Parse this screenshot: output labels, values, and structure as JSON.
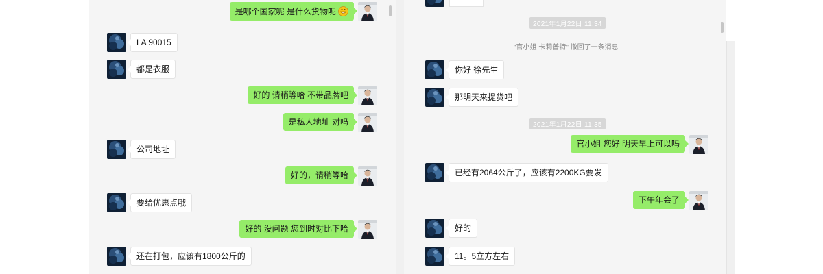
{
  "left_chat": {
    "messages": [
      {
        "dir": "out",
        "text": "是哪个国家呢 是什么货物呢",
        "emoji": "grin-emoji"
      },
      {
        "dir": "in",
        "text": "LA 90015"
      },
      {
        "dir": "in",
        "text": "都是衣服"
      },
      {
        "dir": "out",
        "text": "好的 请稍等哈 不带品牌吧"
      },
      {
        "dir": "out",
        "text": "是私人地址 对吗"
      },
      {
        "dir": "in",
        "text": "公司地址"
      },
      {
        "dir": "out",
        "text": "好的，请稍等哈"
      },
      {
        "dir": "in",
        "text": "要给优惠点哦"
      },
      {
        "dir": "out",
        "text": "好的 没问题 您到时对比下哈"
      },
      {
        "dir": "in",
        "text": "还在打包，应该有1800公斤的"
      }
    ]
  },
  "right_chat": {
    "timestamp_1": "2021年1月22日 11:34",
    "recall_notice": "\"官小姐 卡莉普特\" 撤回了一条消息",
    "timestamp_2": "2021年1月22日 11:35",
    "messages": [
      {
        "dir": "in",
        "text": "你好 徐先生"
      },
      {
        "dir": "in",
        "text": "那明天来提货吧"
      },
      {
        "dir": "out",
        "text": "官小姐 您好 明天早上可以吗"
      },
      {
        "dir": "in",
        "text": "已经有2064公斤了，应该有2200KG要发"
      },
      {
        "dir": "out",
        "text": "下午年会了"
      },
      {
        "dir": "in",
        "text": "好的"
      },
      {
        "dir": "in",
        "text": "11。5立方左右"
      }
    ]
  },
  "colors": {
    "bubble_out": "#95ec69",
    "bubble_in": "#ffffff",
    "panel_bg": "#f5f5f5",
    "timestamp_bg": "#d7d7d7"
  },
  "icons": {
    "contact_avatar": "blue-abstract-avatar",
    "self_avatar": "man-in-suit-avatar"
  }
}
